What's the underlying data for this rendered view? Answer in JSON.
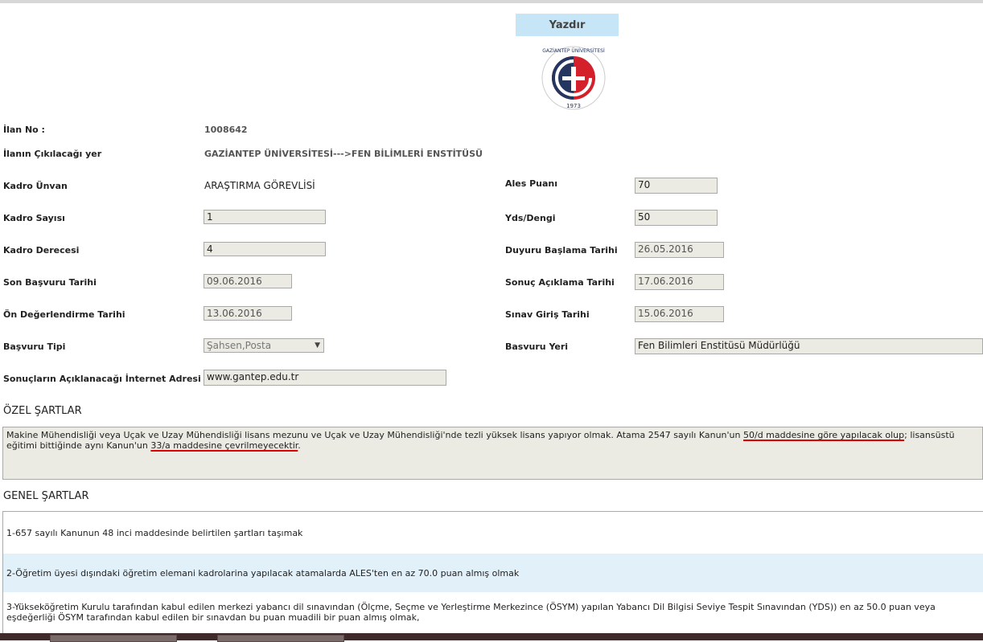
{
  "print_button": "Yazdır",
  "logo": {
    "ring_text": "GAZİANTEP ÜNİVERSİTESİ",
    "year": "1973",
    "brand_red": "#d3202b",
    "brand_navy": "#24365f"
  },
  "ilan": {
    "no_label": "İlan No :",
    "no_value": "1008642",
    "yer_label": "İlanın Çıkılacağı yer",
    "yer_value": "GAZİANTEP ÜNİVERSİTESİ--->FEN BİLİMLERİ ENSTİTÜSÜ"
  },
  "left": {
    "kadro_unvan_label": "Kadro Ünvan",
    "kadro_unvan_value": "ARAŞTIRMA GÖREVLİSİ",
    "kadro_sayisi_label": "Kadro Sayısı",
    "kadro_sayisi_value": "1",
    "kadro_derecesi_label": "Kadro Derecesi",
    "kadro_derecesi_value": "4",
    "son_basvuru_label": "Son Başvuru Tarihi",
    "son_basvuru_value": "09.06.2016",
    "on_deger_label": "Ön Değerlendirme Tarihi",
    "on_deger_value": "13.06.2016",
    "basvuru_tipi_label": "Başvuru Tipi",
    "basvuru_tipi_value": "Şahsen,Posta",
    "internet_label": "Sonuçların Açıklanacağı İnternet Adresi",
    "internet_value": "www.gantep.edu.tr"
  },
  "right": {
    "ales_label": "Ales Puanı",
    "ales_value": "70",
    "yds_label": "Yds/Dengi",
    "yds_value": "50",
    "duyuru_label": "Duyuru Başlama Tarihi",
    "duyuru_value": "26.05.2016",
    "sonuc_label": "Sonuç Açıklama Tarihi",
    "sonuc_value": "17.06.2016",
    "sinav_label": "Sınav Giriş Tarihi",
    "sinav_value": "15.06.2016",
    "basvuru_yeri_label": "Basvuru Yeri",
    "basvuru_yeri_value": "Fen Bilimleri Enstitüsü Müdürlüğü"
  },
  "ozel": {
    "title": "ÖZEL ŞARTLAR",
    "text_a": "Makine Mühendisliği veya Uçak ve Uzay Mühendisliği lisans mezunu ve Uçak ve Uzay Mühendisliği'nde tezli yüksek lisans yapıyor olmak. Atama 2547 sayılı Kanun'un ",
    "text_u1": "50/d maddesine göre yapılacak olup",
    "text_b": "; lisansüstü eğitimi bittiğinde aynı Kanun'un ",
    "text_u2": "33/a maddesine çevrilmeyecektir",
    "text_c": "."
  },
  "genel": {
    "title": "GENEL ŞARTLAR",
    "items": [
      "1-657 sayılı Kanunun 48 inci maddesinde belirtilen şartları taşımak",
      "2-Öğretim üyesi dışındaki öğretim elemani kadrolarina yapılacak atamalarda ALES'ten en az 70.0 puan almış olmak",
      "3-Yükseköğretim Kurulu tarafından kabul edilen merkezi yabancı dil sınavından (Ölçme, Seçme ve Yerleştirme Merkezince (ÖSYM) yapılan Yabancı Dil Bilgisi Seviye Tespit Sınavından (YDS)) en az 50.0 puan veya eşdeğerliği ÖSYM tarafından kabul edilen bir sınavdan bu puan muadili bir puan almış olmak,"
    ]
  }
}
